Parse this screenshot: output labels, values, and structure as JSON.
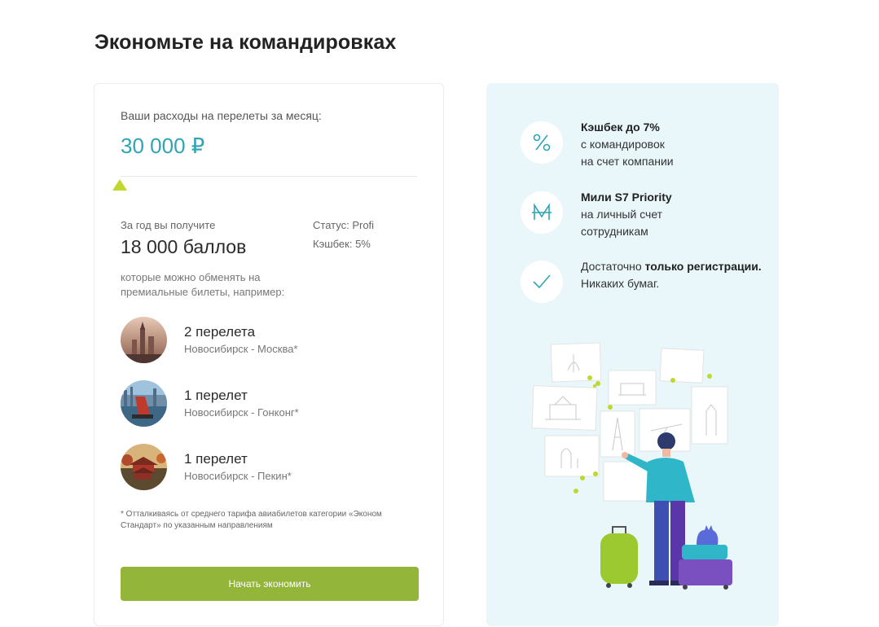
{
  "page": {
    "title": "Экономьте на командировках"
  },
  "calculator": {
    "spend_label": "Ваши расходы на перелеты за месяц:",
    "spend_value": "30 000 ₽",
    "year_label": "За год вы получите",
    "year_points": "18 000 баллов",
    "status": "Статус: Profi",
    "cashback": "Кэшбек: 5%",
    "exchange_text": "которые можно обменять на премиальные билеты, например:",
    "trips": [
      {
        "title": "2 перелета",
        "route": "Новосибирск - Москва*"
      },
      {
        "title": "1 перелет",
        "route": "Новосибирск - Гонконг*"
      },
      {
        "title": "1 перелет",
        "route": "Новосибирск - Пекин*"
      }
    ],
    "footnote": "* Отталкиваясь от среднего тарифа авиабилетов категории «Эконом Стандарт» по указанным направлениям",
    "button_label": "Начать экономить"
  },
  "benefits": [
    {
      "icon": "percent-icon",
      "line1_bold": "Кэшбек до 7%",
      "line2": "с командировок",
      "line3": "на счет компании"
    },
    {
      "icon": "miles-icon",
      "line1_bold": "Мили S7 Priority",
      "line2": "на личный счет",
      "line3": "сотрудникам"
    },
    {
      "icon": "check-icon",
      "pre": "Достаточно ",
      "bold": "только регистрации.",
      "after": "Никаких бумаг."
    }
  ],
  "colors": {
    "accent": "#2fa4b4",
    "button": "#93b53a",
    "slider": "#c1d72e",
    "panel_bg": "#e9f7fb"
  }
}
